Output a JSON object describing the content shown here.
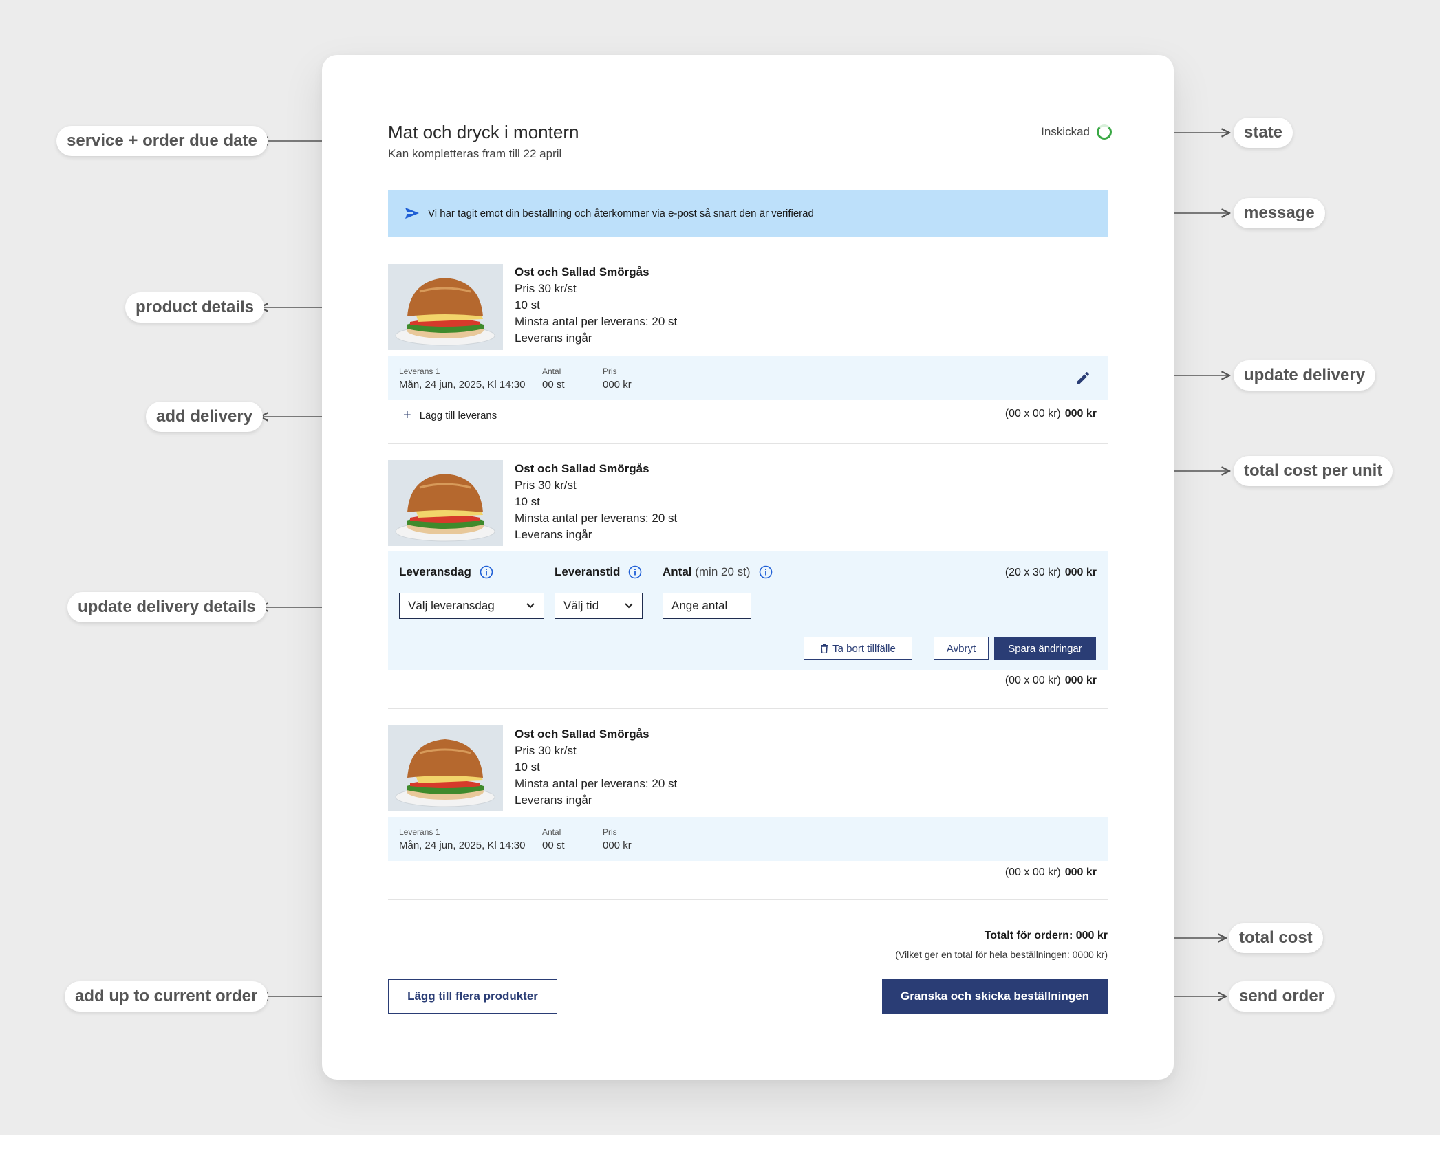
{
  "header": {
    "title": "Mat och dryck i montern",
    "subtitle": "Kan kompletteras fram till 22 april",
    "state_label": "Inskickad"
  },
  "message": {
    "text": "Vi har tagit emot din beställning och återkommer via e-post så snart den är verifierad"
  },
  "products": [
    {
      "name": "Ost och Sallad Smörgås",
      "price": "Pris 30 kr/st",
      "quantity": "10 st",
      "min_per_delivery": "Minsta antal per leverans: 20 st",
      "delivery_included": "Leverans ingår",
      "delivery": {
        "label": "Leverans 1",
        "date": "Mån, 24 jun, 2025, Kl 14:30",
        "qty_label": "Antal",
        "qty": "00 st",
        "price_label": "Pris",
        "price": "000 kr"
      },
      "add_delivery": "Lägg till leverans",
      "cost_formula": "(00 x 00 kr)",
      "cost_total": "000 kr"
    },
    {
      "name": "Ost och Sallad Smörgås",
      "price": "Pris 30 kr/st",
      "quantity": "10 st",
      "min_per_delivery": "Minsta antal per leverans: 20 st",
      "delivery_included": "Leverans ingår",
      "edit": {
        "day_label": "Leveransdag",
        "time_label": "Leveranstid",
        "qty_label": "Antal",
        "qty_hint": "(min 20 st)",
        "day_select": "Välj leveransdag",
        "time_select": "Välj tid",
        "qty_input": "Ange antal",
        "formula": "(20 x 30 kr)",
        "formula_total": "000 kr",
        "remove_label": "Ta bort tillfälle",
        "cancel_label": "Avbryt",
        "save_label": "Spara ändringar"
      },
      "cost_formula": "(00 x 00 kr)",
      "cost_total": "000 kr"
    },
    {
      "name": "Ost och Sallad Smörgås",
      "price": "Pris 30 kr/st",
      "quantity": "10 st",
      "min_per_delivery": "Minsta antal per leverans: 20 st",
      "delivery_included": "Leverans ingår",
      "delivery": {
        "label": "Leverans 1",
        "date": "Mån, 24 jun, 2025, Kl 14:30",
        "qty_label": "Antal",
        "qty": "00 st",
        "price_label": "Pris",
        "price": "000 kr"
      },
      "cost_formula": "(00 x 00 kr)",
      "cost_total": "000 kr"
    }
  ],
  "totals": {
    "order_total": "Totalt för ordern: 000 kr",
    "overall_total": "(Vilket ger en total för hela beställningen: 0000 kr)"
  },
  "actions": {
    "add_products": "Lägg till flera produkter",
    "submit": "Granska och skicka beställningen"
  },
  "annotations": {
    "service_date": "service + order due date",
    "state": "state",
    "message": "message",
    "product_details": "product details",
    "update_delivery": "update delivery",
    "add_delivery": "add delivery",
    "total_cost_per_unit": "total cost per unit",
    "update_delivery_details": "update delivery details",
    "total_cost": "total cost",
    "add_up": "add up to current order",
    "send_order": "send order"
  },
  "colors": {
    "primary": "#2a3d75",
    "message_bg": "#bde0fa",
    "delivery_bg": "#ecf6fd",
    "state_green": "#3aa845",
    "page_bg": "#ececec"
  }
}
